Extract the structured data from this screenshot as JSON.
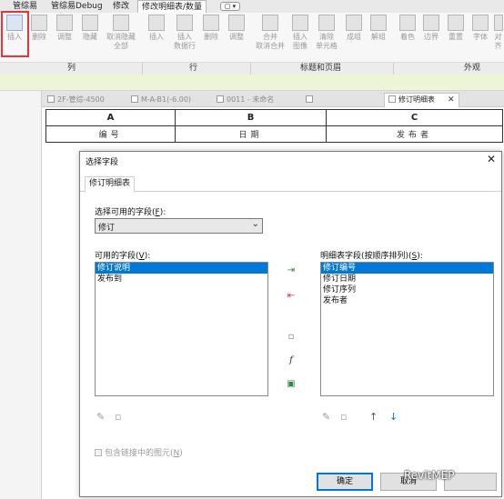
{
  "ribbon_tabs": [
    {
      "label": "管综易"
    },
    {
      "label": "管综易Debug"
    },
    {
      "label": "修改"
    },
    {
      "label": "修改明细表/数量",
      "active": true
    }
  ],
  "ribbon_pill": "▢ ▾",
  "ribbon_buttons": [
    {
      "label": "插入"
    },
    {
      "label": "删除"
    },
    {
      "label": "调整"
    },
    {
      "label": "隐藏"
    },
    {
      "label": "取消隐藏\n全部"
    },
    {
      "label": "插入"
    },
    {
      "label": "插入\n数据行"
    },
    {
      "label": "删除"
    },
    {
      "label": "调整"
    },
    {
      "label": "合并\n取消合并"
    },
    {
      "label": "插入\n图像"
    },
    {
      "label": "清除\n单元格"
    },
    {
      "label": "成组"
    },
    {
      "label": "解组"
    },
    {
      "label": "着色"
    },
    {
      "label": "边界"
    },
    {
      "label": "重置"
    },
    {
      "label": "字体"
    },
    {
      "label": "对齐"
    }
  ],
  "ribbon_groups": {
    "col": "列",
    "row": "行",
    "titles": "标题和页眉",
    "appearance": "外观"
  },
  "view_tabs": [
    {
      "label": "2F-管综-4500"
    },
    {
      "label": "M-A-B1(-6.00)"
    },
    {
      "label": "0011 - 未命名"
    },
    {
      "label": ""
    },
    {
      "label": "修订明细表",
      "active": true
    }
  ],
  "view_close": "✕",
  "schedule": {
    "columns": [
      "A",
      "B",
      "C"
    ],
    "fields": [
      "编号",
      "日期",
      "发布者"
    ]
  },
  "dialog": {
    "title": "选择字段",
    "close": "✕",
    "tab": "修订明细表",
    "select_label_pre": "选择可用的字段(",
    "select_label_key": "F",
    "select_label_post": "):",
    "select_value": "修订",
    "available_label_pre": "可用的字段(",
    "available_label_key": "V",
    "available_label_post": "):",
    "available_fields": [
      "修订说明",
      "发布到"
    ],
    "scheduled_label_pre": "明细表字段(按顺序排列)(",
    "scheduled_label_key": "S",
    "scheduled_label_post": "):",
    "scheduled_fields": [
      "修订编号",
      "修订日期",
      "修订序列",
      "发布者"
    ],
    "checkbox_pre": "包含链接中的图元(",
    "checkbox_key": "N",
    "checkbox_post": ")",
    "ok": "确定",
    "cancel": "取消"
  },
  "watermark": "RevitMEP"
}
